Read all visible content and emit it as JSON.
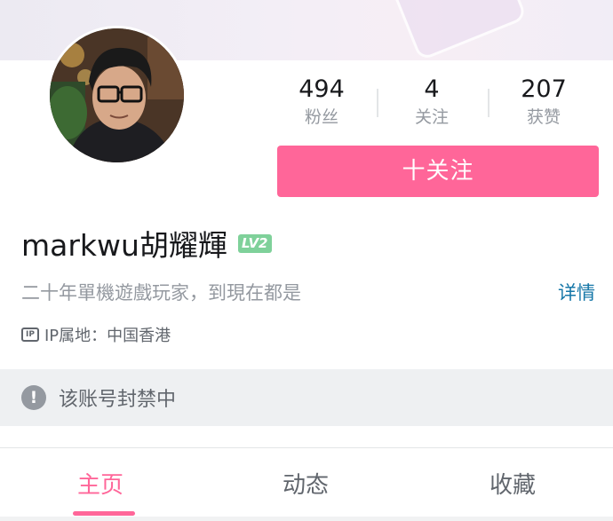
{
  "profile": {
    "username": "markwu胡耀輝",
    "level": "LV2",
    "signature": "二十年單機遊戲玩家，到現在都是",
    "detail_link": "详情",
    "ip_location": "IP属地：中国香港",
    "ip_icon_text": "IP"
  },
  "stats": [
    {
      "value": "494",
      "label": "粉丝"
    },
    {
      "value": "4",
      "label": "关注"
    },
    {
      "value": "207",
      "label": "获赞"
    }
  ],
  "follow_button": {
    "label": "十关注"
  },
  "ban_notice": {
    "icon": "!",
    "text": "该账号封禁中"
  },
  "tabs": [
    {
      "label": "主页",
      "active": true
    },
    {
      "label": "动态",
      "active": false
    },
    {
      "label": "收藏",
      "active": false
    }
  ],
  "colors": {
    "accent": "#ff6699",
    "level_badge": "#7fd19a",
    "link": "#1677a8",
    "muted_text": "#9499a0"
  },
  "icons": {
    "ip": "ip-badge-icon",
    "ban": "exclamation-circle-icon"
  }
}
